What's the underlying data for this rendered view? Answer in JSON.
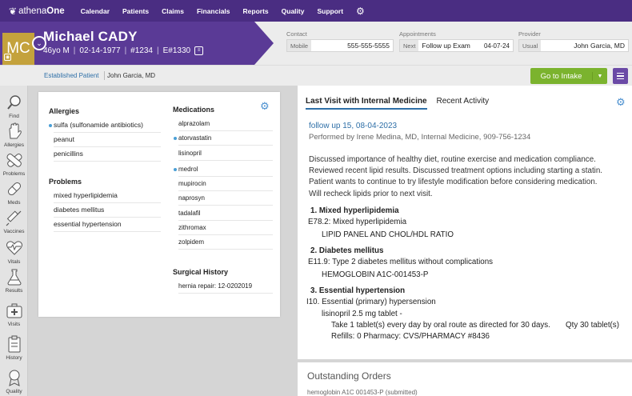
{
  "nav": {
    "logo_prefix": "athena",
    "logo_suffix": "One",
    "items": [
      "Calendar",
      "Patients",
      "Claims",
      "Financials",
      "Reports",
      "Quality",
      "Support"
    ]
  },
  "patient": {
    "initials": "MC",
    "name": "Michael CADY",
    "age_sex": "46yo M",
    "dob": "02-14-1977",
    "id": "#1234",
    "enterprise_id": "E#1330"
  },
  "contact": {
    "label": "Contact",
    "key": "Mobile",
    "value": "555-555-5555"
  },
  "appointments": {
    "label": "Appointments",
    "key": "Next",
    "value": "Follow up Exam",
    "date": "04-07-24"
  },
  "provider": {
    "label": "Provider",
    "key": "Usual",
    "value": "John Garcia, MD"
  },
  "subbar": {
    "status": "Established Patient",
    "provider": "John Garcia, MD",
    "goto_label": "Go to Intake"
  },
  "sidebar": [
    "Find",
    "Allergies",
    "Problems",
    "Meds",
    "Vaccines",
    "Vitals",
    "Results",
    "Visits",
    "History",
    "Quality"
  ],
  "allergies": {
    "title": "Allergies",
    "items": [
      "sulfa (sulfonamide antibiotics)",
      "peanut",
      "penicillins"
    ]
  },
  "problems": {
    "title": "Problems",
    "items": [
      "mixed hyperlipidemia",
      "diabetes mellitus",
      "essential hypertension"
    ]
  },
  "medications": {
    "title": "Medications",
    "items": [
      "alprazolam",
      "atorvastatin",
      "lisinopril",
      "medrol",
      "mupirocin",
      "naprosyn",
      "tadalafil",
      "zithromax",
      "zolpidem"
    ]
  },
  "surgical": {
    "title": "Surgical History",
    "items": [
      "hernia repair: 12-0202019"
    ]
  },
  "right": {
    "tabs": [
      "Last Visit with Internal Medicine",
      "Recent Activity"
    ],
    "visit_title": "follow up 15, 08-04-2023",
    "visit_by": "Performed by Irene Medina, MD, Internal Medicine, 909-756-1234",
    "narrative": [
      "Discussed importance of healthy diet, routine exercise and medication compliance.",
      "Reviewed recent lipid results.  Discussed treatment options including starting a statin.",
      "Patient wants to continue to try lifestyle modification before considering medication.",
      "Will recheck lipids prior to next visit."
    ],
    "dx1_title": "1.  Mixed hyperlipidemia",
    "dx1_code": "E78.2: Mixed hyperlipidemia",
    "dx1_order": "LIPID PANEL AND CHOL/HDL RATIO",
    "dx2_title": "2.  Diabetes mellitus",
    "dx2_code": "E11.9: Type 2 diabetes mellitus without complications",
    "dx2_order": "HEMOGLOBIN A1C-001453-P",
    "dx3_title": "3.  Essential hypertension",
    "dx3_code": "I10. Essential (primary) hypersension",
    "dx3_med": "lisinopril 2.5 mg tablet -",
    "dx3_sig": "Take 1 tablet(s) every day by oral route as directed for 30 days.",
    "dx3_qty": "Qty 30 tablet(s)",
    "dx3_refills": "Refills: 0    Pharmacy: CVS/PHARMACY #8436",
    "orders_title": "Outstanding Orders",
    "orders_peek": "hemoglobin A1C 001453-P (submitted)"
  }
}
